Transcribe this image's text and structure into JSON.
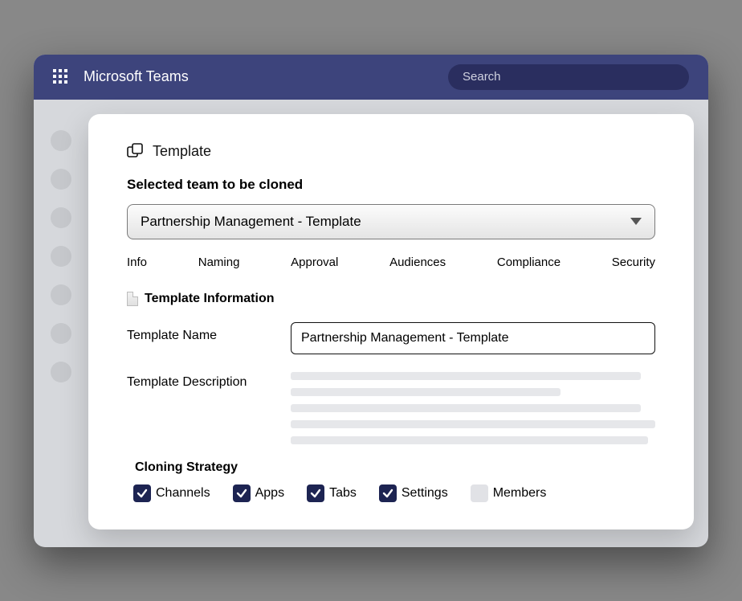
{
  "header": {
    "app_title": "Microsoft Teams",
    "search_placeholder": "Search"
  },
  "panel": {
    "template_label": "Template",
    "selected_team_label": "Selected team to be cloned",
    "dropdown_value": "Partnership Management - Template",
    "tabs": [
      "Info",
      "Naming",
      "Approval",
      "Audiences",
      "Compliance",
      "Security"
    ],
    "info_heading": "Template Information",
    "name_label": "Template Name",
    "name_value": "Partnership Management - Template",
    "desc_label": "Template Description",
    "cloning_heading": "Cloning Strategy",
    "checks": {
      "channels": "Channels",
      "apps": "Apps",
      "tabs": "Tabs",
      "settings": "Settings",
      "members": "Members"
    }
  }
}
